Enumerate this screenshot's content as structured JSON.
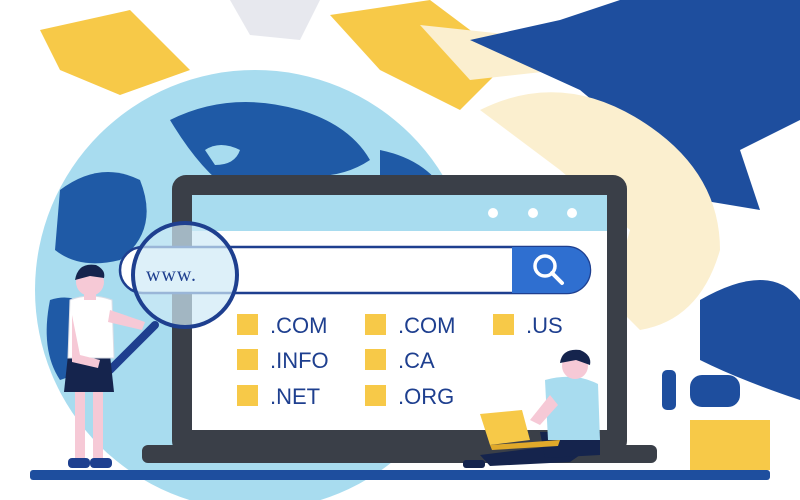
{
  "search": {
    "value": "www."
  },
  "domains": [
    {
      "label": ".COM"
    },
    {
      "label": ".COM"
    },
    {
      "label": ".US"
    },
    {
      "label": ".INFO"
    },
    {
      "label": ".CA"
    },
    {
      "label": ".NET"
    },
    {
      "label": ".ORG"
    }
  ],
  "icons": {
    "search": "magnifier-icon",
    "window_dots": "window-dots-icon",
    "bullet": "square-bullet-icon"
  },
  "colors": {
    "navy": "#1e3f8f",
    "monitor": "#3a3f48",
    "globe": "#a8dcef",
    "continents": "#1f5aa6",
    "bullet": "#f7c948",
    "cream": "#fbefcf"
  }
}
